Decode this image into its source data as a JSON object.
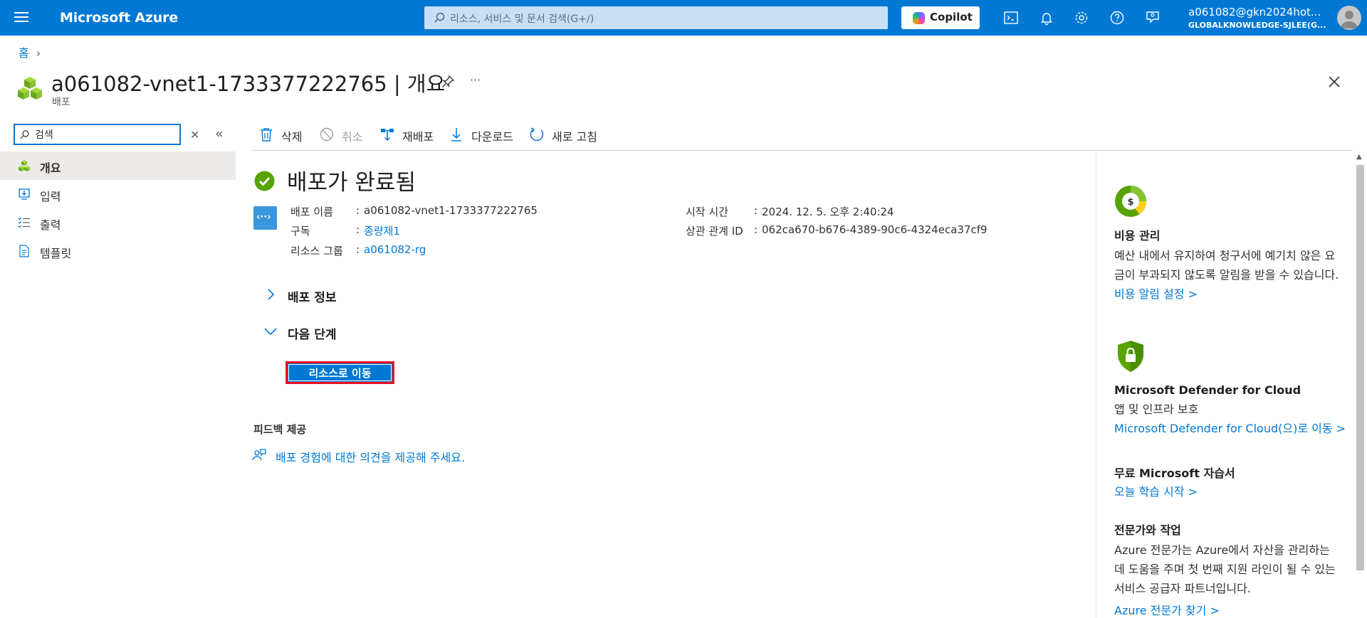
{
  "topbar": {
    "brand": "Microsoft Azure",
    "search_placeholder": "리소스, 서비스 및 문서 검색(G+/)",
    "copilot_label": "Copilot",
    "account_name": "a061082@gkn2024hot...",
    "account_directory": "GLOBALKNOWLEDGE-SJLEE(G..."
  },
  "breadcrumb": {
    "home": "홈",
    "separator": "›"
  },
  "header": {
    "title": "a061082-vnet1-1733377222765 | 개요",
    "subtitle": "배포",
    "more": "···"
  },
  "nav": {
    "search_value": "검색",
    "clear": "✕",
    "collapse": "«",
    "items": [
      {
        "label": "개요",
        "icon": "deployment-cubes-icon",
        "active": true
      },
      {
        "label": "입력",
        "icon": "input-icon",
        "active": false
      },
      {
        "label": "출력",
        "icon": "output-list-icon",
        "active": false
      },
      {
        "label": "템플릿",
        "icon": "template-doc-icon",
        "active": false
      }
    ]
  },
  "commands": [
    {
      "label": "삭제",
      "icon": "trash-icon",
      "disabled": false
    },
    {
      "label": "취소",
      "icon": "cancel-icon",
      "disabled": true
    },
    {
      "label": "재배포",
      "icon": "redeploy-icon",
      "disabled": false
    },
    {
      "label": "다운로드",
      "icon": "download-icon",
      "disabled": false
    },
    {
      "label": "새로 고침",
      "icon": "refresh-icon",
      "disabled": false
    }
  ],
  "status": {
    "title": "배포가 완료됨",
    "icon": "success-check-icon",
    "deploy_icon_glyph": "‹··›"
  },
  "details_left": [
    {
      "key": "배포 이름",
      "value": "a061082-vnet1-1733377222765",
      "link": false
    },
    {
      "key": "구독",
      "value": "종량제1",
      "link": true
    },
    {
      "key": "리소스 그룹",
      "value": "a061082-rg",
      "link": true
    }
  ],
  "details_right": [
    {
      "key": "시작 시간",
      "value": "2024. 12. 5. 오후 2:40:24",
      "link": false
    },
    {
      "key": "상관 관계 ID",
      "value": "062ca670-b676-4389-90c6-4324eca37cf9",
      "link": false
    }
  ],
  "colon": ":",
  "sections": {
    "deploy_info": "배포 정보",
    "next_steps": "다음 단계",
    "go_to_resource": "리소스로 이동"
  },
  "feedback": {
    "heading": "피드백 제공",
    "link": "배포 경험에 대한 의견을 제공해 주세요."
  },
  "right_pane": [
    {
      "title": "비용 관리",
      "desc": "예산 내에서 유지하여 청구서에 예기치 않은 요금이 부과되지 않도록 알림을 받을 수 있습니다.",
      "link": "비용 알림 설정 >"
    },
    {
      "title": "Microsoft Defender for Cloud",
      "desc": "앱 및 인프라 보호",
      "link": "Microsoft Defender for Cloud(으)로 이동 >"
    },
    {
      "title": "무료 Microsoft 자습서",
      "desc": "",
      "link": "오늘 학습 시작 >"
    },
    {
      "title": "전문가와 작업",
      "desc": "Azure 전문가는 Azure에서 자산을 관리하는 데 도움을 주며 첫 번째 지원 라인이 될 수 있는 서비스 공급자 파트너입니다.",
      "link": "Azure 전문가 찾기 >"
    }
  ],
  "colors": {
    "accent": "#0078d4",
    "success": "#57a300",
    "highlight_border": "#e81123"
  }
}
